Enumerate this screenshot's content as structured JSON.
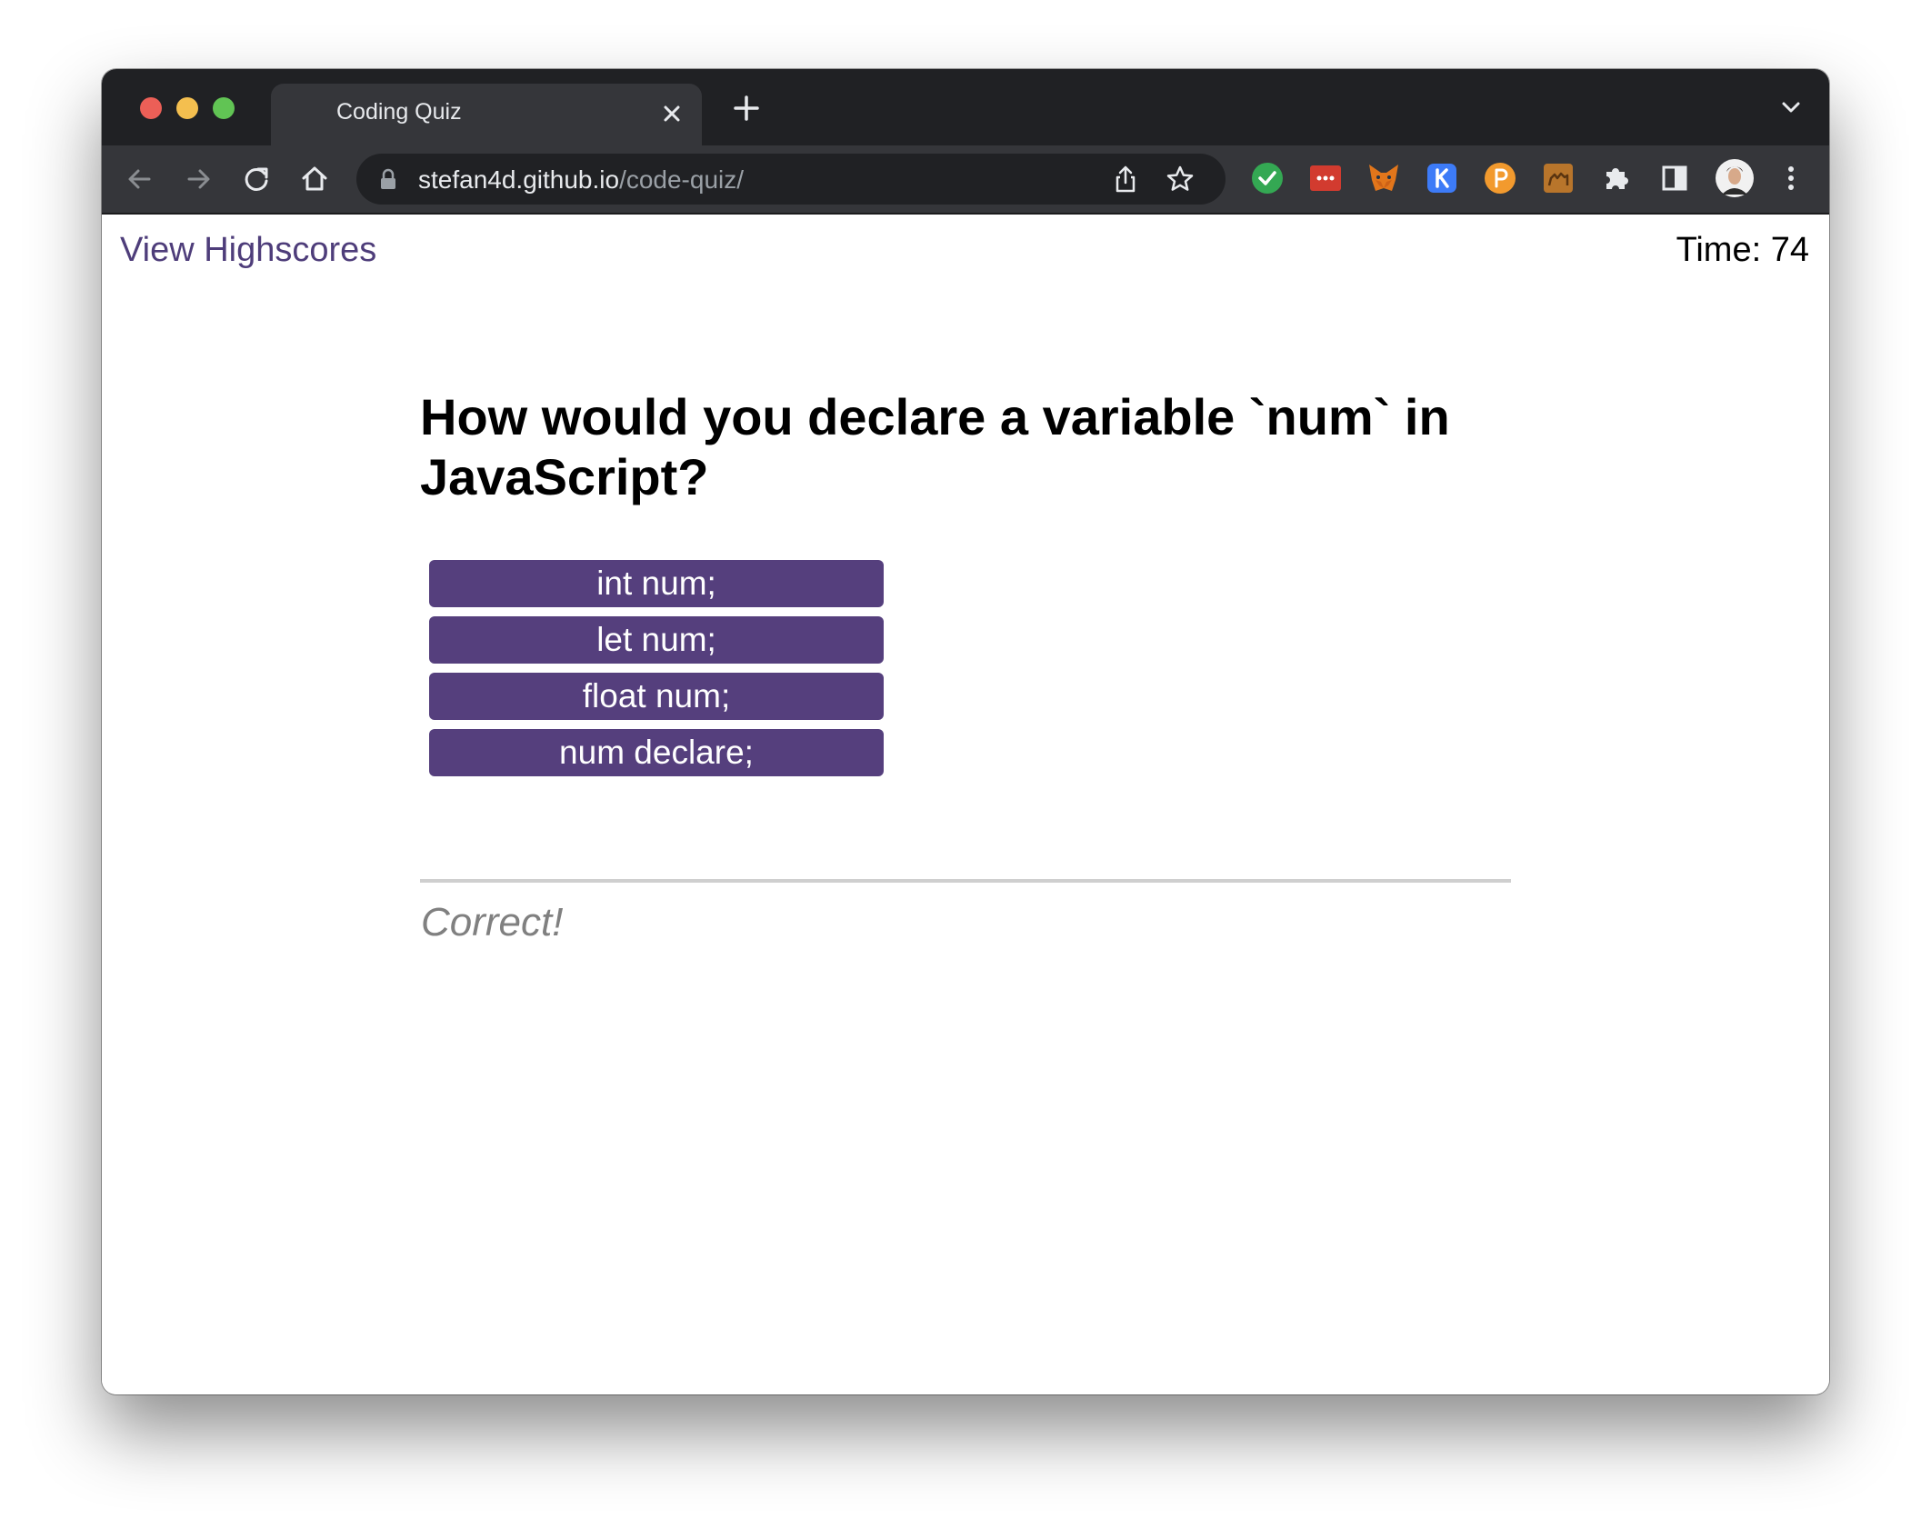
{
  "browser": {
    "tab": {
      "title": "Coding Quiz",
      "close_icon": "close-icon"
    },
    "new_tab_icon": "plus-icon",
    "tab_search_icon": "chevron-down-icon",
    "nav": {
      "back_icon": "arrow-left-icon",
      "forward_icon": "arrow-right-icon",
      "reload_icon": "reload-icon",
      "home_icon": "home-icon"
    },
    "address": {
      "host": "stefan4d.github.io",
      "path": "/code-quiz/",
      "lock_icon": "lock-icon",
      "share_icon": "share-icon",
      "bookmark_icon": "star-icon"
    },
    "extensions": [
      "check-extension-icon",
      "password-manager-extension-icon",
      "metamask-fox-icon",
      "k-extension-icon",
      "p-extension-icon",
      "camel-extension-icon",
      "puzzle-extensions-icon",
      "side-panel-icon",
      "profile-avatar",
      "more-menu-icon"
    ],
    "colors": {
      "frame": "#202124",
      "toolbar": "#35363a"
    }
  },
  "header": {
    "highscores_link": "View Highscores",
    "timer_label": "Time: ",
    "timer_value": "74"
  },
  "quiz": {
    "question": "How would you declare a variable `num` in JavaScript?",
    "choices": [
      "int num;",
      "let num;",
      "float num;",
      "num declare;"
    ],
    "feedback": "Correct!",
    "accent_color": "#553f7d"
  }
}
